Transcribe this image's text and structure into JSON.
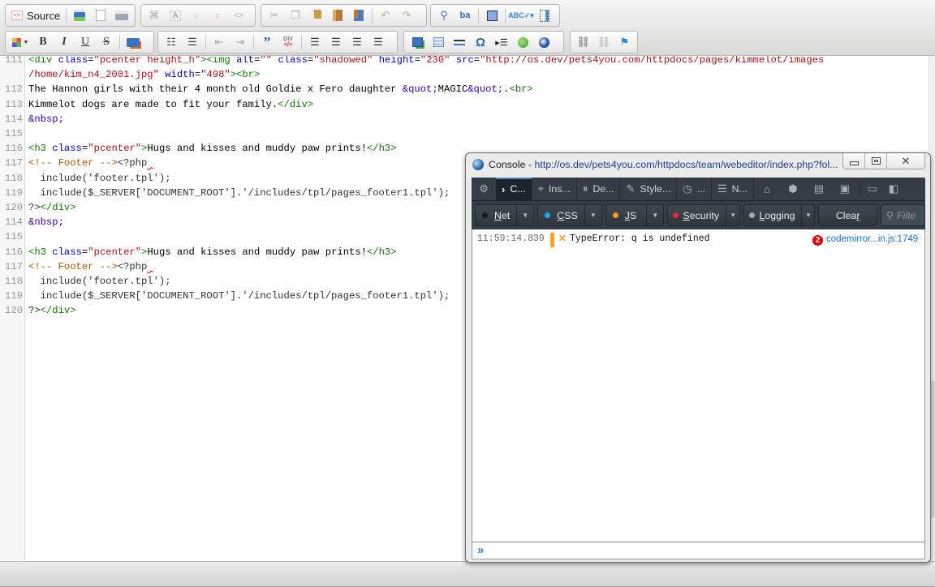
{
  "toolbar": {
    "row1": {
      "source_label": "Source",
      "groups": [
        [
          "save-icon",
          "preview-icon",
          "print-icon"
        ],
        [
          "find-icon",
          "select-all-icon",
          "insert-comment-icon",
          "remove-comment-icon",
          "code-tag-icon"
        ],
        [
          "cut-icon",
          "copy-icon",
          "paste-icon",
          "paste-text-icon",
          "paste-word-icon",
          "undo-icon",
          "redo-icon"
        ],
        [
          "search-icon",
          "replace-icon",
          "maximize-icon",
          "spellcheck-icon",
          "show-blocks-icon"
        ]
      ]
    },
    "row2": {
      "format_buttons": [
        "B",
        "I",
        "U",
        "S"
      ],
      "div_label": "DIV"
    }
  },
  "editor": {
    "lines": [
      {
        "num": "111",
        "html": "<span class='tag'>&lt;div</span> <span class='attr'>class</span>=<span class='str'>\"pcenter height_h\"</span><span class='tag'>&gt;&lt;img</span> <span class='attr'>alt</span>=<span class='str'>\"\"</span> <span class='attr'>class</span>=<span class='str'>\"shadowed\"</span> <span class='attr'>height</span>=<span class='str'>\"230\"</span> <span class='attr'>src</span>=<span class='str'>\"http://os.dev/pets4you.com/httpdocs/pages/kimmelot/images</span>"
      },
      {
        "num": "",
        "html": "<span class='str'>/home/kim_n4_2001.jpg\"</span> <span class='attr'>width</span>=<span class='str'>\"498\"</span><span class='tag'>&gt;&lt;br&gt;</span>"
      },
      {
        "num": "112",
        "html": "The Hannon girls with their 4 month old Goldie x Fero daughter <span class='ent'>&amp;quot;</span>MAGIC<span class='ent'>&amp;quot;</span>.<span class='tag'>&lt;br&gt;</span>"
      },
      {
        "num": "113",
        "html": "Kimmelot dogs are made to fit your family.<span class='tag'>&lt;/div&gt;</span>"
      },
      {
        "num": "114",
        "html": "<span class='ent'>&amp;nbsp;</span>"
      },
      {
        "num": "115",
        "html": ""
      },
      {
        "num": "116",
        "html": "<span class='tag'>&lt;h3</span> <span class='attr'>class</span>=<span class='str'>\"pcenter\"</span><span class='tag'>&gt;</span>Hugs and kisses and muddy paw prints!<span class='tag'>&lt;/h3&gt;</span>"
      },
      {
        "num": "117",
        "html": "<span class='cmt'>&lt;!-- Footer --&gt;</span><span class='php'>&lt;?php<span class='squig'> </span></span>"
      },
      {
        "num": "118",
        "html": "<span class='php'>  include('footer.tpl');</span>"
      },
      {
        "num": "119",
        "html": "<span class='php'>  include($_SERVER['DOCUMENT_ROOT'].'/includes/tpl/pages_footer1.tpl');</span>"
      },
      {
        "num": "120",
        "html": "<span class='php'>?&gt;</span><span class='tag'>&lt;/div&gt;</span>"
      },
      {
        "num": "114",
        "html": "<span class='ent'>&amp;nbsp;</span>"
      },
      {
        "num": "115",
        "html": ""
      },
      {
        "num": "116",
        "html": "<span class='tag'>&lt;h3</span> <span class='attr'>class</span>=<span class='str'>\"pcenter\"</span><span class='tag'>&gt;</span>Hugs and kisses and muddy paw prints!<span class='tag'>&lt;/h3&gt;</span>"
      },
      {
        "num": "117",
        "html": "<span class='cmt'>&lt;!-- Footer --&gt;</span><span class='php'>&lt;?php<span class='squig'> </span></span>"
      },
      {
        "num": "118",
        "html": "<span class='php'>  include('footer.tpl');</span>"
      },
      {
        "num": "119",
        "html": "<span class='php'>  include($_SERVER['DOCUMENT_ROOT'].'/includes/tpl/pages_footer1.tpl');</span>"
      },
      {
        "num": "120",
        "html": "<span class='php'>?&gt;</span><span class='tag'>&lt;/div&gt;</span>"
      }
    ]
  },
  "console": {
    "title_prefix": "Console - ",
    "title_url": "http://os.dev/pets4you.com/httpdocs/team/webeditor/index.php?fol...",
    "tabs": [
      {
        "label": "C...",
        "icon": "›",
        "name": "console"
      },
      {
        "label": "Ins...",
        "icon": "⌖",
        "name": "inspector"
      },
      {
        "label": "De...",
        "icon": "⏸",
        "name": "debugger"
      },
      {
        "label": "Style...",
        "icon": "✎",
        "name": "style-editor"
      },
      {
        "label": "...",
        "icon": "◷",
        "name": "profiler"
      },
      {
        "label": "N...",
        "icon": "☰",
        "name": "network"
      }
    ],
    "filters": [
      {
        "label": "Net",
        "underline": "N",
        "rest": "et",
        "color": "#1a1a1a"
      },
      {
        "label": "CSS",
        "underline": "C",
        "rest": "SS",
        "color": "#1eaaf1"
      },
      {
        "label": "JS",
        "underline": "J",
        "rest": "S",
        "color": "#f29d1f"
      },
      {
        "label": "Security",
        "underline": "S",
        "rest": "ecurity",
        "color": "#e32b2b"
      },
      {
        "label": "Logging",
        "underline": "L",
        "rest": "ogging",
        "color": "#a8a8a8"
      }
    ],
    "clear_label_main": "Clea",
    "clear_label_u": "r",
    "filter_placeholder": "Filte",
    "log": {
      "time": "11:59:14.839",
      "message": "TypeError: q is undefined",
      "count": "2",
      "source": "codemirror...in.js:1749"
    },
    "prompt": "»"
  }
}
